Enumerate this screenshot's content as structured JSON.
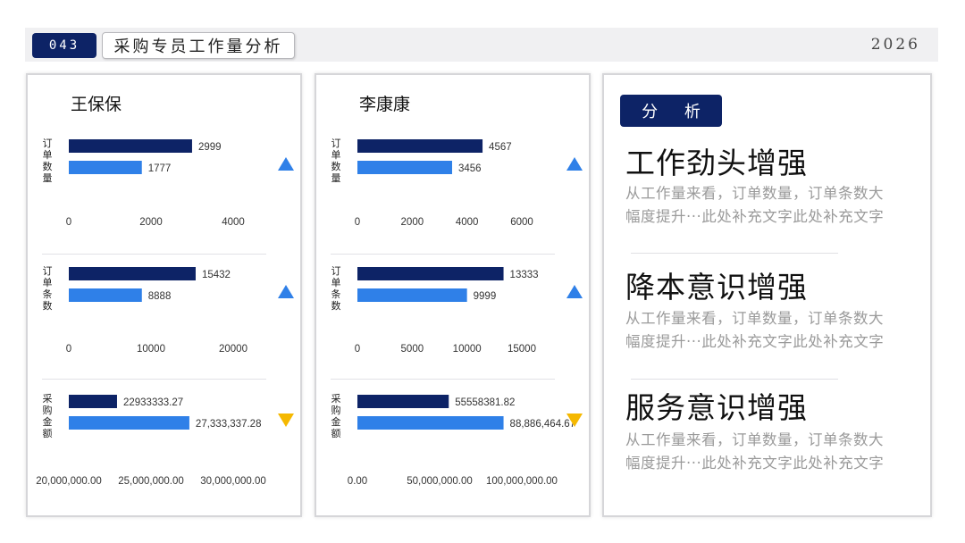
{
  "header": {
    "page_number": "043",
    "title": "采购专员工作量分析",
    "year": "2026"
  },
  "colors": {
    "navy": "#0d2366",
    "blue": "#2f80e8",
    "up": "#2f80e8",
    "down": "#f5b800"
  },
  "panels": [
    {
      "name": "王保保"
    },
    {
      "name": "李康康"
    }
  ],
  "chart_data": [
    {
      "type": "bar",
      "person": "王保保",
      "category": "订单数量",
      "values": [
        2999,
        1777
      ],
      "value_labels": [
        "2999",
        "1777"
      ],
      "xlim": [
        0,
        4000
      ],
      "ticks": [
        0,
        2000,
        4000
      ],
      "tick_labels": [
        "0",
        "2000",
        "4000"
      ],
      "trend": "up"
    },
    {
      "type": "bar",
      "person": "王保保",
      "category": "订单条数",
      "values": [
        15432,
        8888
      ],
      "value_labels": [
        "15432",
        "8888"
      ],
      "xlim": [
        0,
        20000
      ],
      "ticks": [
        0,
        10000,
        20000
      ],
      "tick_labels": [
        "0",
        "10000",
        "20000"
      ],
      "trend": "up"
    },
    {
      "type": "bar",
      "person": "王保保",
      "category": "采购金额",
      "values": [
        22933333.27,
        27333337.28
      ],
      "value_labels": [
        "22933333.27",
        "27,333,337.28"
      ],
      "xlim": [
        20000000,
        30000000
      ],
      "ticks": [
        20000000,
        25000000,
        30000000
      ],
      "tick_labels": [
        "20,000,000.00",
        "25,000,000.00",
        "30,000,000.00"
      ],
      "trend": "down"
    },
    {
      "type": "bar",
      "person": "李康康",
      "category": "订单数量",
      "values": [
        4567,
        3456
      ],
      "value_labels": [
        "4567",
        "3456"
      ],
      "xlim": [
        0,
        6000
      ],
      "ticks": [
        0,
        2000,
        4000,
        6000
      ],
      "tick_labels": [
        "0",
        "2000",
        "4000",
        "6000"
      ],
      "trend": "up"
    },
    {
      "type": "bar",
      "person": "李康康",
      "category": "订单条数",
      "values": [
        13333,
        9999
      ],
      "value_labels": [
        "13333",
        "9999"
      ],
      "xlim": [
        0,
        15000
      ],
      "ticks": [
        0,
        5000,
        10000,
        15000
      ],
      "tick_labels": [
        "0",
        "5000",
        "10000",
        "15000"
      ],
      "trend": "up"
    },
    {
      "type": "bar",
      "person": "李康康",
      "category": "采购金额",
      "values": [
        55558381.82,
        88886464.67
      ],
      "value_labels": [
        "55558381.82",
        "88,886,464.67"
      ],
      "xlim": [
        0,
        100000000
      ],
      "ticks": [
        0,
        50000000,
        100000000
      ],
      "tick_labels": [
        "0.00",
        "50,000,000.00",
        "100,000,000.00"
      ],
      "trend": "down"
    }
  ],
  "analysis": {
    "label": "分 析",
    "points": [
      {
        "title": "工作劲头增强",
        "line1": "从工作量来看，订单数量，订单条数大",
        "line2": "幅度提升···此处补充文字此处补充文字"
      },
      {
        "title": "降本意识增强",
        "line1": "从工作量来看，订单数量，订单条数大",
        "line2": "幅度提升···此处补充文字此处补充文字"
      },
      {
        "title": "服务意识增强",
        "line1": "从工作量来看，订单数量，订单条数大",
        "line2": "幅度提升···此处补充文字此处补充文字"
      }
    ]
  }
}
